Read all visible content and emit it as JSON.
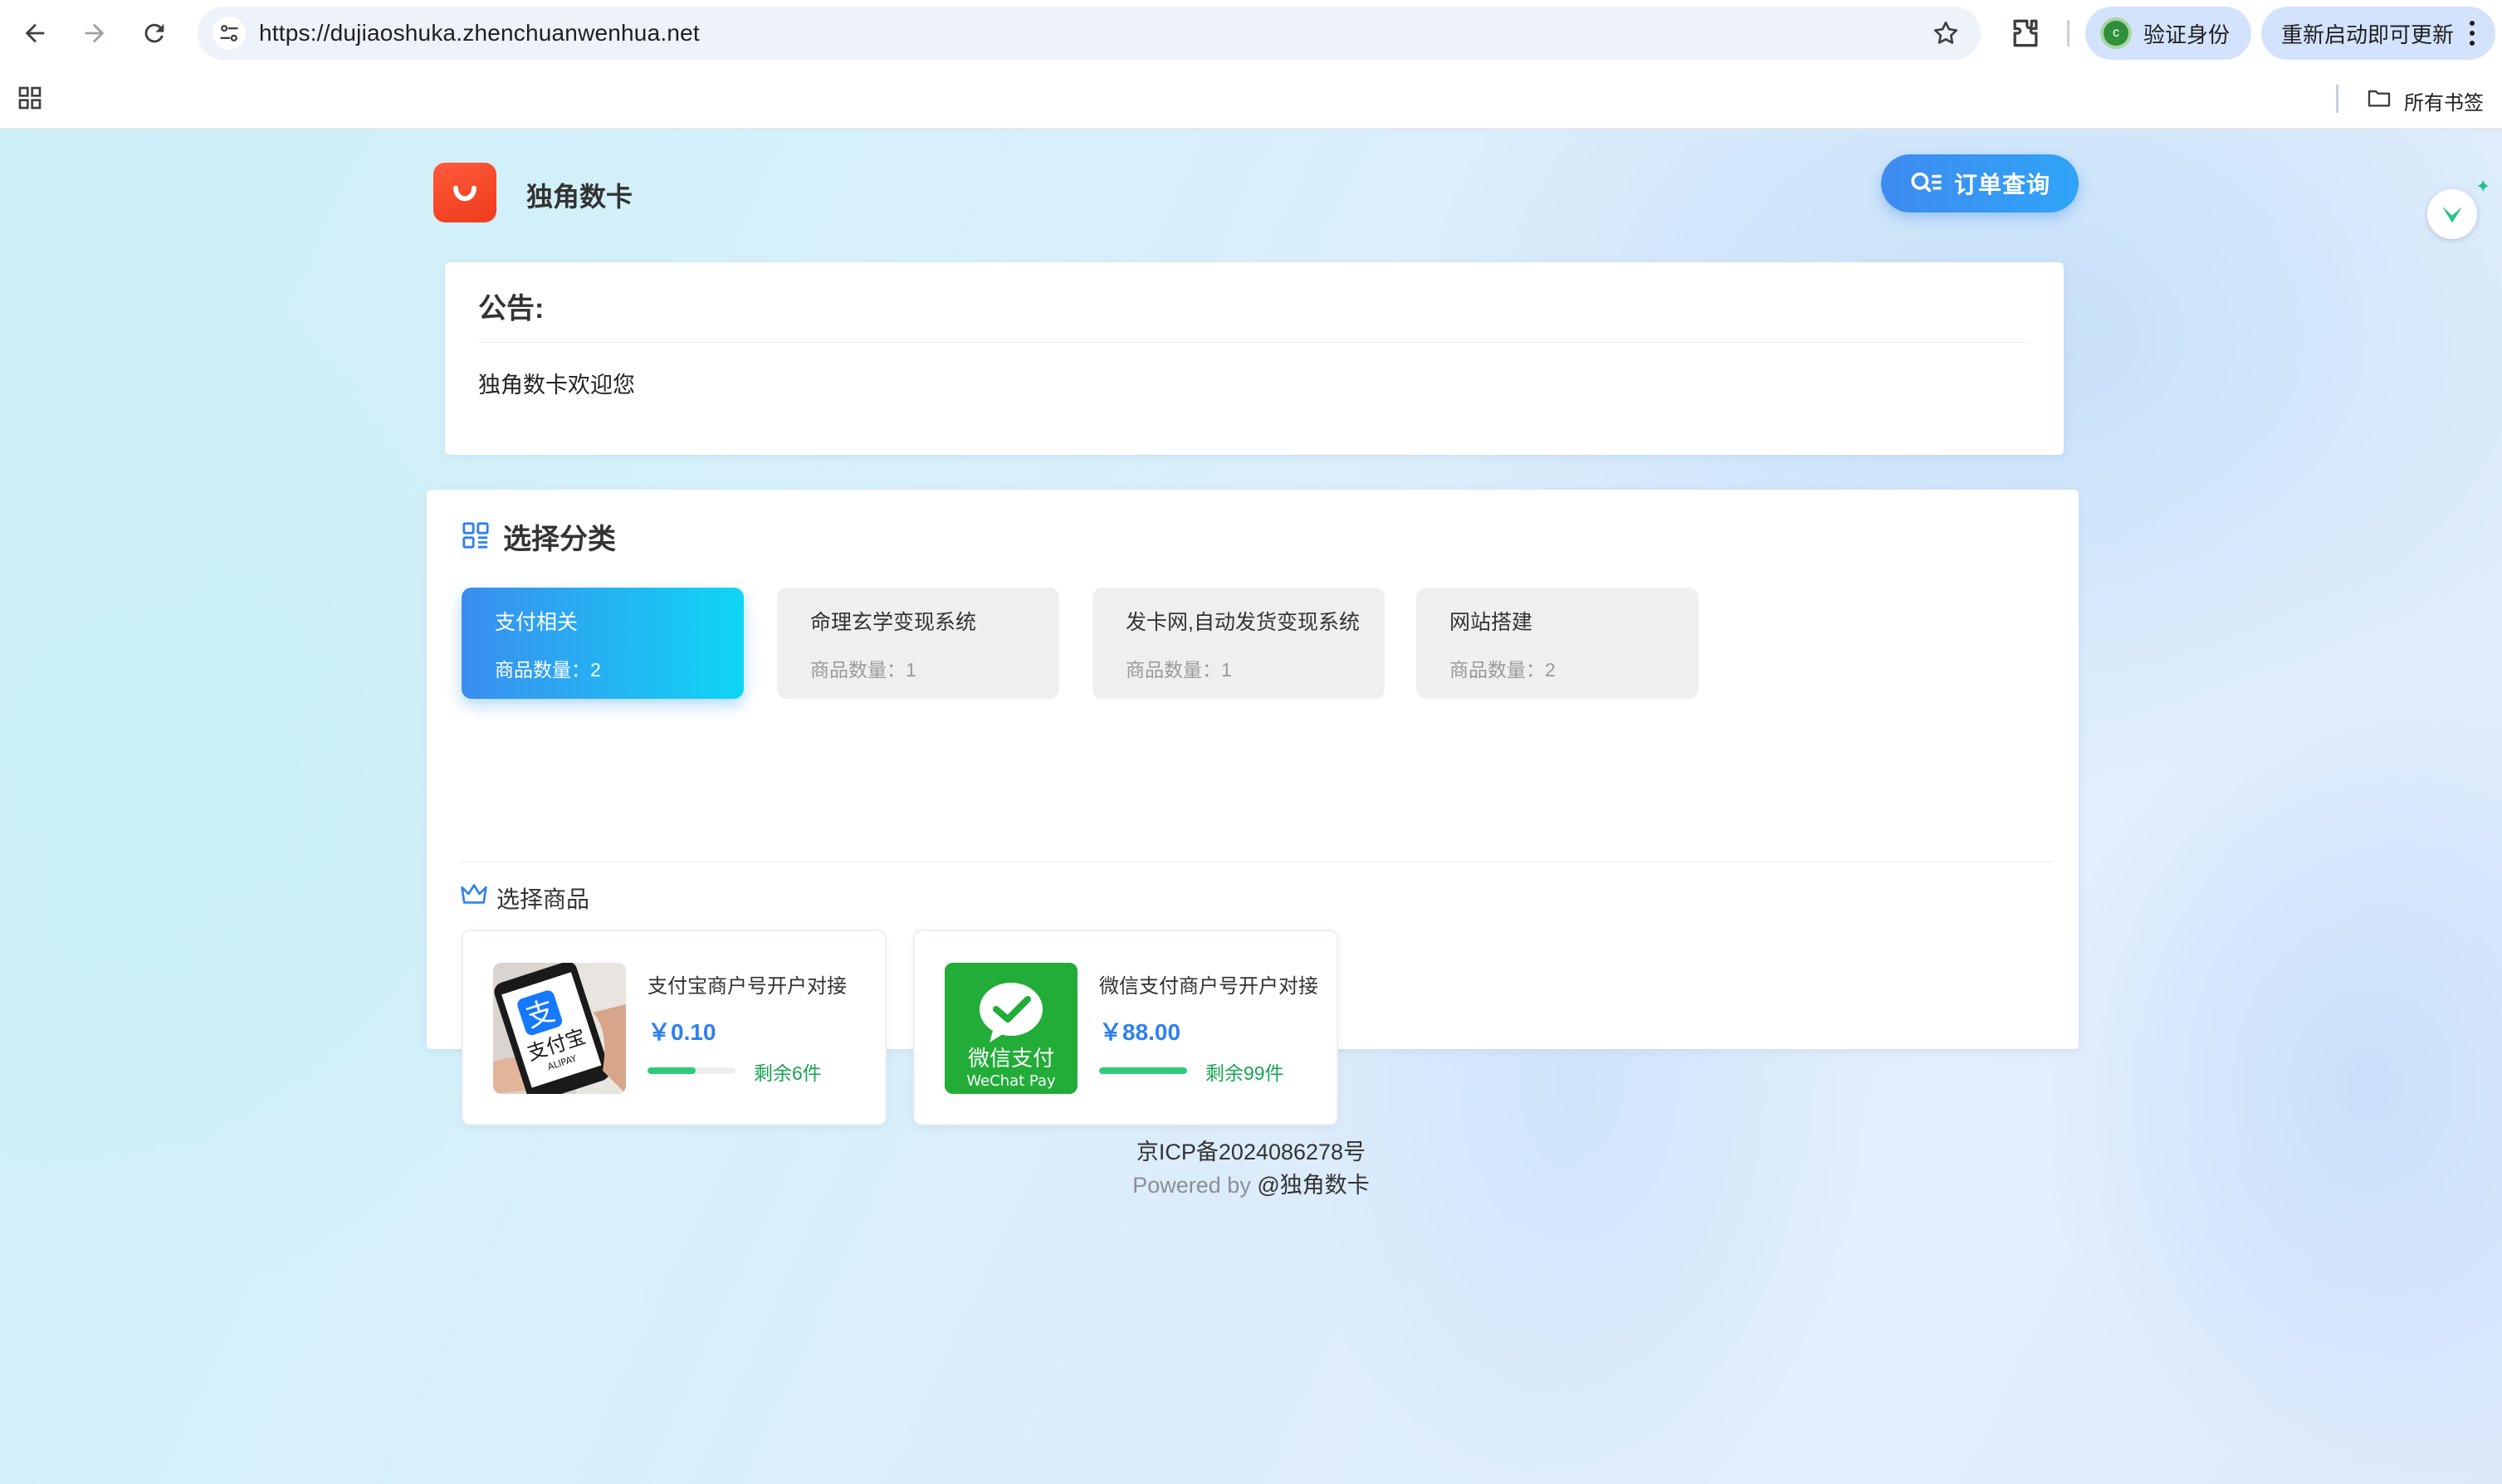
{
  "browser": {
    "url": "https://dujiaoshuka.zhenchuanwenhua.net",
    "verify_label": "验证身份",
    "verify_avatar_letter": "c",
    "restart_label": "重新启动即可更新",
    "bookmarks_label": "所有书签"
  },
  "site": {
    "name": "独角数卡",
    "order_query_label": "订单查询",
    "brand_color": "#2f80ed"
  },
  "notice": {
    "title": "公告:",
    "body": "独角数卡欢迎您"
  },
  "categories": {
    "title": "选择分类",
    "items": [
      {
        "name": "支付相关",
        "count_text": "商品数量：2",
        "active": true
      },
      {
        "name": "命理玄学变现系统",
        "count_text": "商品数量：1",
        "active": false
      },
      {
        "name": "发卡网,自动发货变现系统",
        "count_text": "商品数量：1",
        "active": false
      },
      {
        "name": "网站搭建",
        "count_text": "商品数量：2",
        "active": false
      }
    ]
  },
  "goods": {
    "title": "选择商品",
    "items": [
      {
        "name": "支付宝商户号开户对接",
        "price": "￥0.10",
        "stock_text": "剩余6件",
        "stock_level": 0.55,
        "image": "alipay-logo"
      },
      {
        "name": "微信支付商户号开户对接",
        "price": "￥88.00",
        "stock_text": "剩余99件",
        "stock_level": 1.0,
        "image": "wechat-pay-logo",
        "image_text_cn": "微信支付",
        "image_text_en": "WeChat Pay"
      }
    ]
  },
  "footer": {
    "icp": "京ICP备2024086278号",
    "powered_prefix": "Powered by",
    "powered_name": "@独角数卡"
  }
}
